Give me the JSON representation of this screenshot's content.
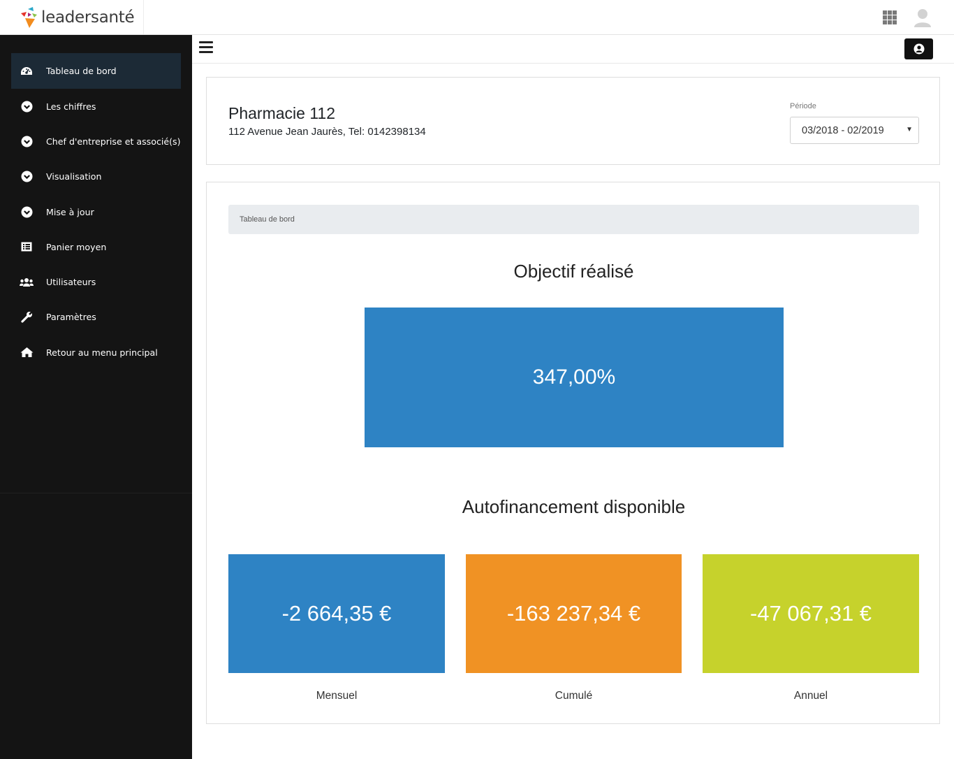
{
  "brand": {
    "name": "leadersanté"
  },
  "topbar": {
    "apps_icon": "grid-icon",
    "avatar_icon": "user-avatar-icon"
  },
  "sidebar": {
    "items": [
      {
        "label": "Tableau de bord",
        "icon": "dashboard-icon",
        "active": true
      },
      {
        "label": "Les chiffres",
        "icon": "chevron-circle-down-icon"
      },
      {
        "label": "Chef d'entreprise et associé(s)",
        "icon": "chevron-circle-down-icon"
      },
      {
        "label": "Visualisation",
        "icon": "chevron-circle-down-icon"
      },
      {
        "label": "Mise à jour",
        "icon": "chevron-circle-down-icon"
      },
      {
        "label": "Panier moyen",
        "icon": "list-icon"
      },
      {
        "label": "Utilisateurs",
        "icon": "users-icon"
      },
      {
        "label": "Paramètres",
        "icon": "wrench-icon"
      },
      {
        "label": "Retour au menu principal",
        "icon": "home-icon"
      }
    ]
  },
  "header": {
    "pharmacy_name": "Pharmacie 112",
    "address": "112 Avenue Jean Jaurès, Tel: 0142398134",
    "period_label": "Période",
    "period_value": "03/2018 - 02/2019"
  },
  "main": {
    "breadcrumb": "Tableau de bord",
    "objective_title": "Objectif réalisé",
    "objective_value": "347,00%",
    "autofin_title": "Autofinancement disponible",
    "tiles": [
      {
        "value": "-2 664,35 €",
        "caption": "Mensuel",
        "color": "#2e83c4"
      },
      {
        "value": "-163 237,34 €",
        "caption": "Cumulé",
        "color": "#f09224"
      },
      {
        "value": "-47 067,31 €",
        "caption": "Annuel",
        "color": "#c6d22c"
      }
    ]
  },
  "colors": {
    "sidebar_bg": "#141414",
    "active_item_bg": "#1c2a36",
    "accent_blue": "#2e83c4"
  }
}
